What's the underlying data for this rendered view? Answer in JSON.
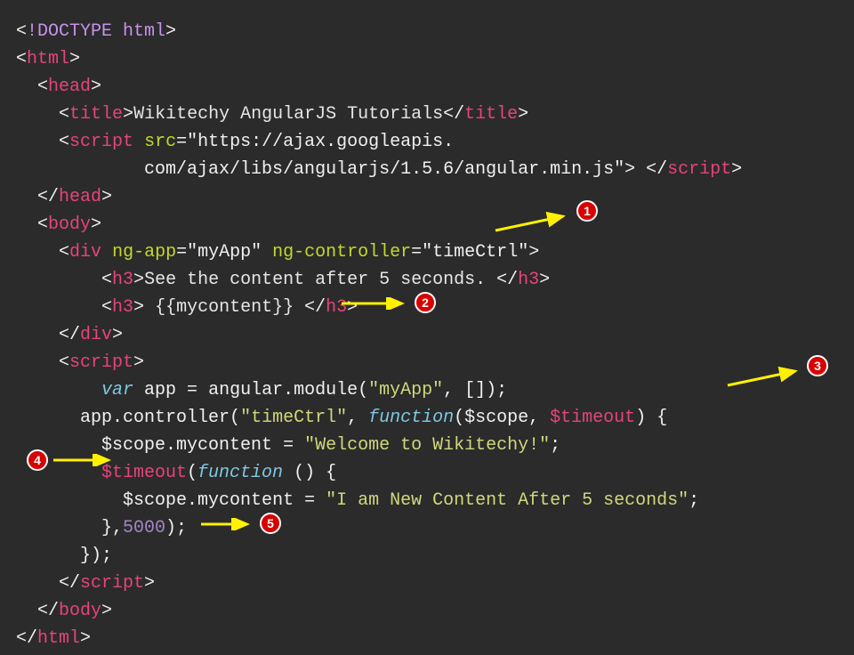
{
  "lines": {
    "l1": {
      "doctype": "!DOCTYPE html"
    },
    "l2": {
      "html": "html"
    },
    "l3": {
      "head": "head"
    },
    "l4": {
      "title_open": "title",
      "title_text": "Wikitechy AngularJS Tutorials",
      "title_close": "title"
    },
    "l5": {
      "script": "script",
      "src_attr": "src",
      "src_val": "\"https://ajax.googleapis."
    },
    "l6": {
      "src_cont": "com/ajax/libs/angularjs/1.5.6/angular.min.js\"",
      "script_close": "script"
    },
    "l7": {
      "head_close": "head"
    },
    "l8": {
      "body": "body"
    },
    "l9": {
      "div": "div",
      "ngapp_attr": "ng-app",
      "ngapp_val": "\"myApp\"",
      "ngc_attr": "ng-controller",
      "ngc_val": "\"timeCtrl\""
    },
    "l10": {
      "h3": "h3",
      "txt": "See the content after 5 seconds. ",
      "h3c": "h3"
    },
    "l11": {
      "h3": "h3",
      "txt": " {{mycontent}} ",
      "h3c": "h3"
    },
    "l12": {
      "divc": "div"
    },
    "l13": {
      "script": "script"
    },
    "l14": {
      "var": "var",
      "app": " app ",
      "eq": "= ",
      "ang": "angular",
      "mod": ".module(",
      "myapp": "\"myApp\"",
      "rest": ", []);"
    },
    "l15": {
      "app": "app",
      "ctrl": ".controller(",
      "tc": "\"timeCtrl\"",
      "c": ", ",
      "fn": "function",
      "paren": "(",
      "s": "$scope",
      "cm": ", ",
      "t": "$timeout",
      "end": ") {"
    },
    "l16": {
      "s": "$scope",
      "mc": ".mycontent ",
      "eq": "= ",
      "str": "\"Welcome to Wikitechy!\"",
      "sc": ";"
    },
    "l17": {
      "t": "$timeout",
      "p": "(",
      "fn": "function",
      "rest": " () {"
    },
    "l18": {
      "s": "$scope",
      "mc": ".mycontent ",
      "eq": "= ",
      "str": "\"I am New Content After 5 seconds\"",
      "sc": ";"
    },
    "l19": {
      "close": "},",
      "num": "5000",
      "end": ");"
    },
    "l20": {
      "close": "});"
    },
    "l21": {
      "script_close": "script"
    },
    "l22": {
      "body_close": "body"
    },
    "l23": {
      "html_close": "html"
    }
  },
  "badges": {
    "b1": "1",
    "b2": "2",
    "b3": "3",
    "b4": "4",
    "b5": "5"
  }
}
